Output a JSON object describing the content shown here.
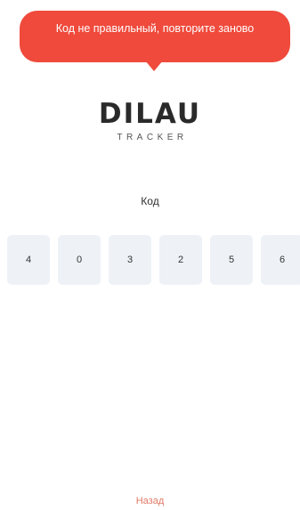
{
  "toast": {
    "message": "Код не правильный, повторите заново",
    "bg_color": "#ef4a3c"
  },
  "logo": {
    "main": "DILAU",
    "sub": "TRACKER"
  },
  "code": {
    "label": "Код",
    "digits": [
      "4",
      "0",
      "3",
      "2",
      "5",
      "6"
    ],
    "cell_color": "#eef2f7"
  },
  "footer": {
    "back_label": "Назад",
    "link_color": "#e07a66"
  }
}
